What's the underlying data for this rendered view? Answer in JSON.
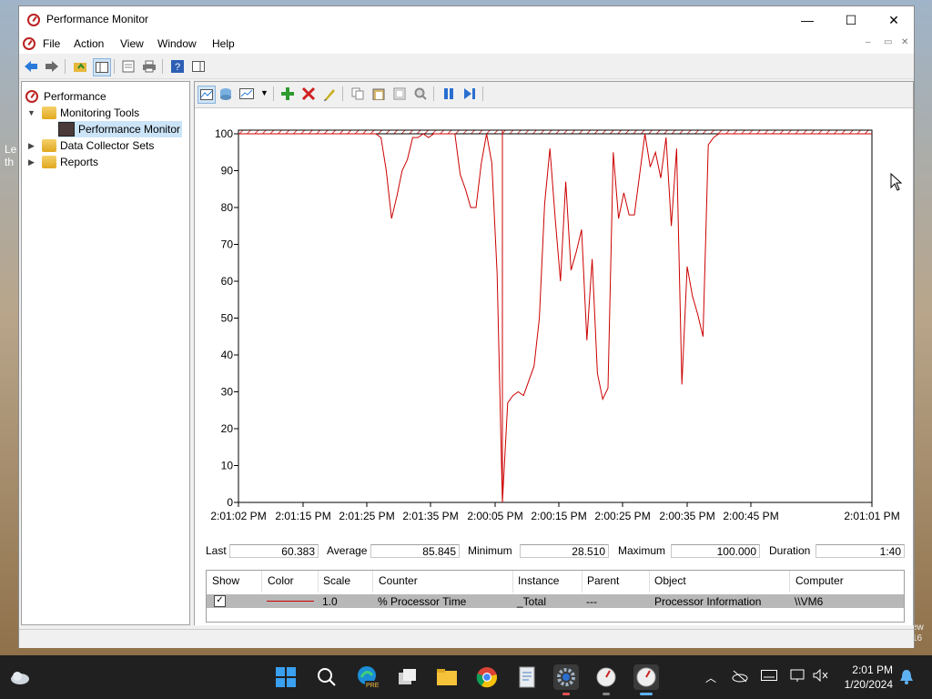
{
  "window": {
    "title": "Performance Monitor",
    "controls": {
      "minimize": "—",
      "maximize": "☐",
      "close": "✕"
    }
  },
  "menu": {
    "items": [
      "File",
      "Action",
      "View",
      "Window",
      "Help"
    ],
    "mdi": {
      "minimize": "–",
      "restore": "▭",
      "close": "✕"
    }
  },
  "tree": {
    "root": "Performance",
    "monitoring_tools": "Monitoring Tools",
    "performance_monitor": "Performance Monitor",
    "data_collector_sets": "Data Collector Sets",
    "reports": "Reports"
  },
  "chart_data": {
    "type": "line",
    "ylim": [
      0,
      100
    ],
    "yticks": [
      0,
      10,
      20,
      30,
      40,
      50,
      60,
      70,
      80,
      90,
      100
    ],
    "xtick_labels": [
      "2:01:02 PM",
      "2:01:15 PM",
      "2:01:25 PM",
      "2:01:35 PM",
      "2:00:05 PM",
      "2:00:15 PM",
      "2:00:25 PM",
      "2:00:35 PM",
      "2:00:45 PM",
      "2:01:01 PM"
    ],
    "series": [
      {
        "name": "% Processor Time",
        "color": "#cc0000",
        "values": [
          100,
          100,
          100,
          100,
          100,
          100,
          100,
          100,
          100,
          100,
          100,
          100,
          100,
          100,
          100,
          100,
          100,
          100,
          100,
          100,
          100,
          100,
          100,
          100,
          100,
          100,
          100,
          99,
          90,
          77,
          83,
          90,
          93,
          99,
          99,
          100,
          99,
          100,
          100,
          100,
          100,
          100,
          89,
          85,
          80,
          80,
          92,
          100,
          92,
          62,
          0,
          27,
          29,
          30,
          29,
          33,
          37,
          50,
          81,
          96,
          77,
          60,
          87,
          63,
          68,
          74,
          44,
          66,
          35,
          28,
          31,
          95,
          77,
          84,
          78,
          78,
          89,
          100,
          91,
          95,
          88,
          99,
          75,
          96,
          32,
          64,
          56,
          51,
          45,
          97,
          99,
          100,
          100,
          100,
          100,
          100,
          100,
          100,
          100,
          100,
          100,
          100,
          100,
          100,
          100,
          100,
          100,
          100,
          100,
          100,
          100,
          100,
          100,
          100,
          100,
          100,
          100,
          100,
          100,
          100,
          100
        ]
      }
    ]
  },
  "stats": {
    "last_label": "Last",
    "last_value": "60.383",
    "average_label": "Average",
    "average_value": "85.845",
    "minimum_label": "Minimum",
    "minimum_value": "28.510",
    "maximum_label": "Maximum",
    "maximum_value": "100.000",
    "duration_label": "Duration",
    "duration_value": "1:40"
  },
  "counters": {
    "headers": [
      "Show",
      "Color",
      "Scale",
      "Counter",
      "Instance",
      "Parent",
      "Object",
      "Computer"
    ],
    "row": {
      "show": "✓",
      "scale": "1.0",
      "counter": "% Processor Time",
      "instance": "_Total",
      "parent": "---",
      "object": "Processor Information",
      "computer": "\\\\VM6"
    }
  },
  "desktop": {
    "left_text_1": "Le",
    "left_text_2": "th",
    "right_text_1": "ew",
    "right_text_2": "16"
  },
  "taskbar": {
    "time": "2:01 PM",
    "date": "1/20/2024",
    "pre_badge": "PRE"
  }
}
